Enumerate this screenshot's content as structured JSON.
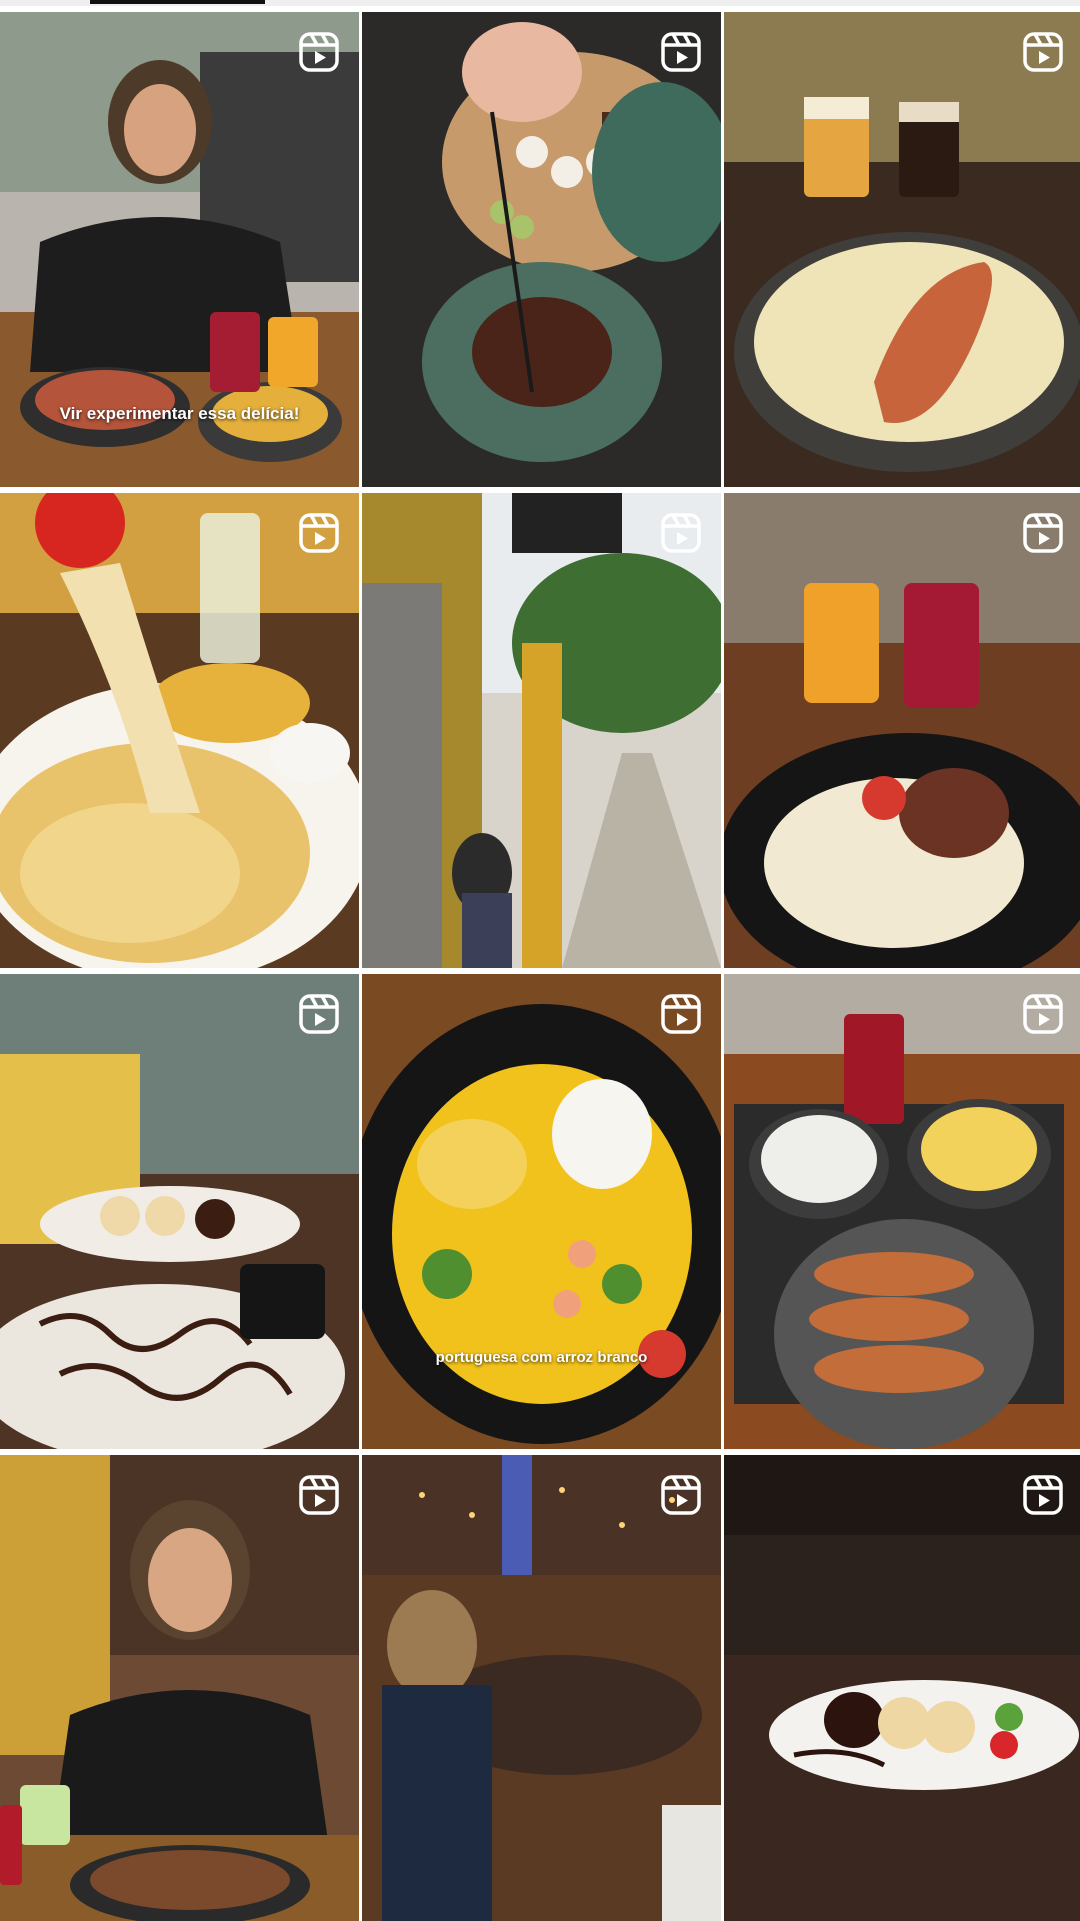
{
  "grid": {
    "tiles": [
      {
        "id": "tile-1",
        "type": "reel",
        "icon": "reel-icon",
        "caption": "Vir experimentar essa delícia!"
      },
      {
        "id": "tile-2",
        "type": "reel",
        "icon": "reel-icon"
      },
      {
        "id": "tile-3",
        "type": "reel",
        "icon": "reel-icon"
      },
      {
        "id": "tile-4",
        "type": "reel",
        "icon": "reel-icon"
      },
      {
        "id": "tile-5",
        "type": "reel",
        "icon": "reel-icon"
      },
      {
        "id": "tile-6",
        "type": "reel",
        "icon": "reel-icon"
      },
      {
        "id": "tile-7",
        "type": "reel",
        "icon": "reel-icon"
      },
      {
        "id": "tile-8",
        "type": "reel",
        "icon": "reel-icon",
        "caption": "portuguesa com arroz branco"
      },
      {
        "id": "tile-9",
        "type": "reel",
        "icon": "reel-icon"
      },
      {
        "id": "tile-10",
        "type": "reel",
        "icon": "reel-icon"
      },
      {
        "id": "tile-11",
        "type": "reel",
        "icon": "reel-icon"
      },
      {
        "id": "tile-12",
        "type": "reel",
        "icon": "reel-icon"
      }
    ]
  },
  "colors": {
    "background": "#ffffff",
    "tab_indicator": "#111111",
    "reel_icon": "#ffffff"
  }
}
